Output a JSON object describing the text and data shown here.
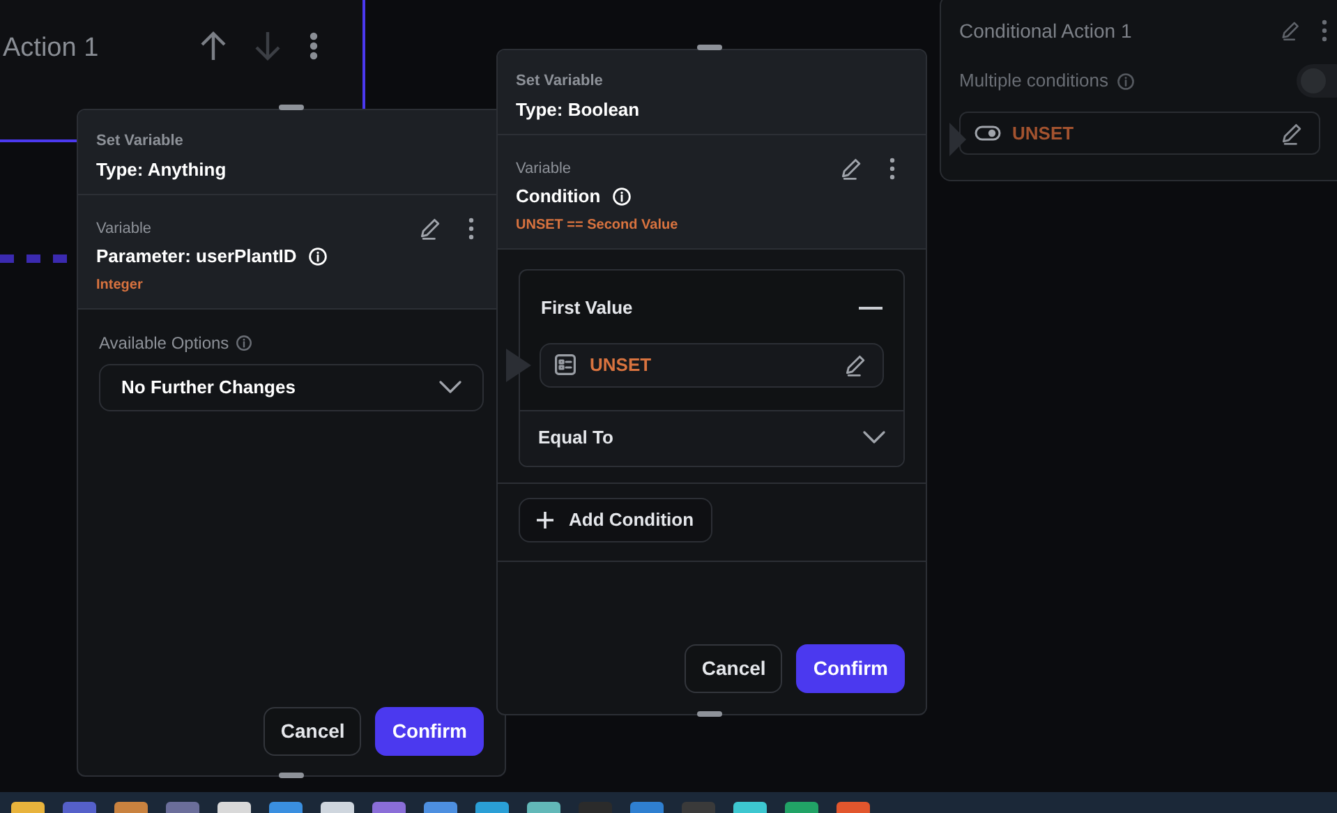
{
  "canvas_node": {
    "title": "Action 1"
  },
  "panel_anything": {
    "heading": "Set Variable",
    "type": "Type: Anything",
    "variable_label": "Variable",
    "variable_name": "Parameter: userPlantID",
    "variable_type": "Integer",
    "options_label": "Available Options",
    "options_value": "No Further Changes",
    "buttons": [
      {
        "label": "Cancel",
        "kind": "secondary"
      },
      {
        "label": "Confirm",
        "kind": "primary"
      }
    ]
  },
  "panel_boolean": {
    "heading": "Set Variable",
    "type": "Type: Boolean",
    "variable_label": "Variable",
    "variable_name": "Condition",
    "expression": "UNSET == Second Value",
    "first_value_label": "First Value",
    "first_value": "UNSET",
    "operator": "Equal To",
    "add_button": "Add Condition",
    "buttons": [
      {
        "label": "Cancel",
        "kind": "secondary"
      },
      {
        "label": "Confirm",
        "kind": "primary"
      }
    ]
  },
  "conditional_action": {
    "title": "Conditional Action 1",
    "multiple_label": "Multiple conditions",
    "multiple_on": false,
    "condition_value": "UNSET"
  }
}
